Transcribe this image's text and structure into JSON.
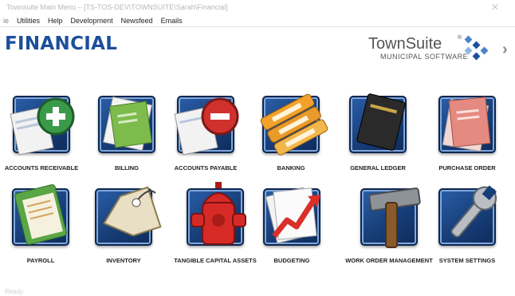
{
  "window": {
    "title": "Townsuite Main Menu – [TS-TOS-DEV\\TOWNSUITE\\Sarah\\Financial]",
    "close_glyph": "✕"
  },
  "menubar": {
    "items": [
      "ie",
      "Utilities",
      "Help",
      "Development",
      "Newsfeed",
      "Emails"
    ]
  },
  "module_title": "FINANCIAL",
  "brand": {
    "name": "TownSuite",
    "registered": "®",
    "subtitle": "MUNICIPAL SOFTWARE",
    "colors": [
      "#1d4f9c",
      "#4a84c9",
      "#8fb5e3"
    ]
  },
  "nav_next_glyph": "›",
  "tiles": [
    {
      "label": "ACCOUNTS RECEIVABLE",
      "icon": "accounts-receivable-icon",
      "accent": "#3a9a4a"
    },
    {
      "label": "BILLING",
      "icon": "billing-icon",
      "accent": "#7dbb4c"
    },
    {
      "label": "ACCOUNTS PAYABLE",
      "icon": "accounts-payable-icon",
      "accent": "#d0312d"
    },
    {
      "label": "BANKING",
      "icon": "banking-icon",
      "accent": "#f2a22b"
    },
    {
      "label": "GENERAL LEDGER",
      "icon": "general-ledger-icon",
      "accent": "#2a2a2a"
    },
    {
      "label": "PURCHASE ORDER",
      "icon": "purchase-order-icon",
      "accent": "#e58a80"
    },
    {
      "label": "PAYROLL",
      "icon": "payroll-icon",
      "accent": "#5aa546"
    },
    {
      "label": "INVENTORY",
      "icon": "inventory-icon",
      "accent": "#e9dfc4"
    },
    {
      "label": "TANGIBLE CAPITAL ASSETS",
      "icon": "fire-hydrant-icon",
      "accent": "#d52a26"
    },
    {
      "label": "BUDGETING",
      "icon": "budgeting-icon",
      "accent": "#d9302a"
    },
    {
      "label": "WORK ORDER MANAGEMENT",
      "icon": "hammer-icon",
      "accent": "#8a5a2b"
    },
    {
      "label": "SYSTEM SETTINGS",
      "icon": "wrench-icon",
      "accent": "#b9bec5"
    }
  ],
  "statusbar": {
    "text": "Ready"
  }
}
